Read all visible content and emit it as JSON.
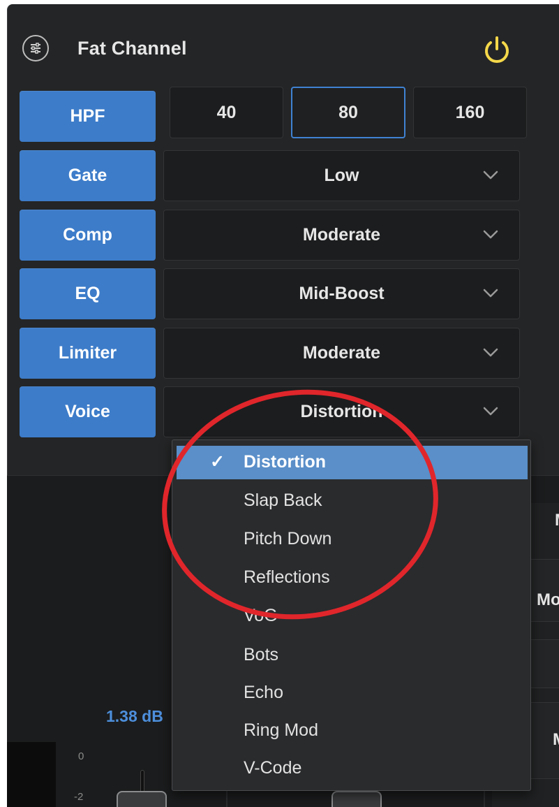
{
  "panel": {
    "title": "Fat Channel",
    "power_color": "#f5d84a",
    "accent_color": "#3d7cc9"
  },
  "rows": [
    {
      "label": "HPF",
      "kind": "segmented"
    },
    {
      "label": "Gate",
      "value": "Low"
    },
    {
      "label": "Comp",
      "value": "Moderate"
    },
    {
      "label": "EQ",
      "value": "Mid-Boost"
    },
    {
      "label": "Limiter",
      "value": "Moderate"
    },
    {
      "label": "Voice",
      "value": "Distortion"
    }
  ],
  "hpf": {
    "options": [
      "40",
      "80",
      "160"
    ],
    "selected": "80"
  },
  "voice_menu": {
    "check_glyph": "✓",
    "selected": "Distortion",
    "items": [
      "Distortion",
      "Slap Back",
      "Pitch Down",
      "Reflections",
      "VoG",
      "Bots",
      "Echo",
      "Ring Mod",
      "V-Code"
    ]
  },
  "mixer": {
    "gain_readout": "1.38 dB",
    "scale": [
      "0",
      "-2"
    ],
    "right_fragments": [
      "M",
      "Mo",
      "M"
    ]
  },
  "annotation": {
    "shape": "ellipse",
    "color": "#e0262b"
  }
}
